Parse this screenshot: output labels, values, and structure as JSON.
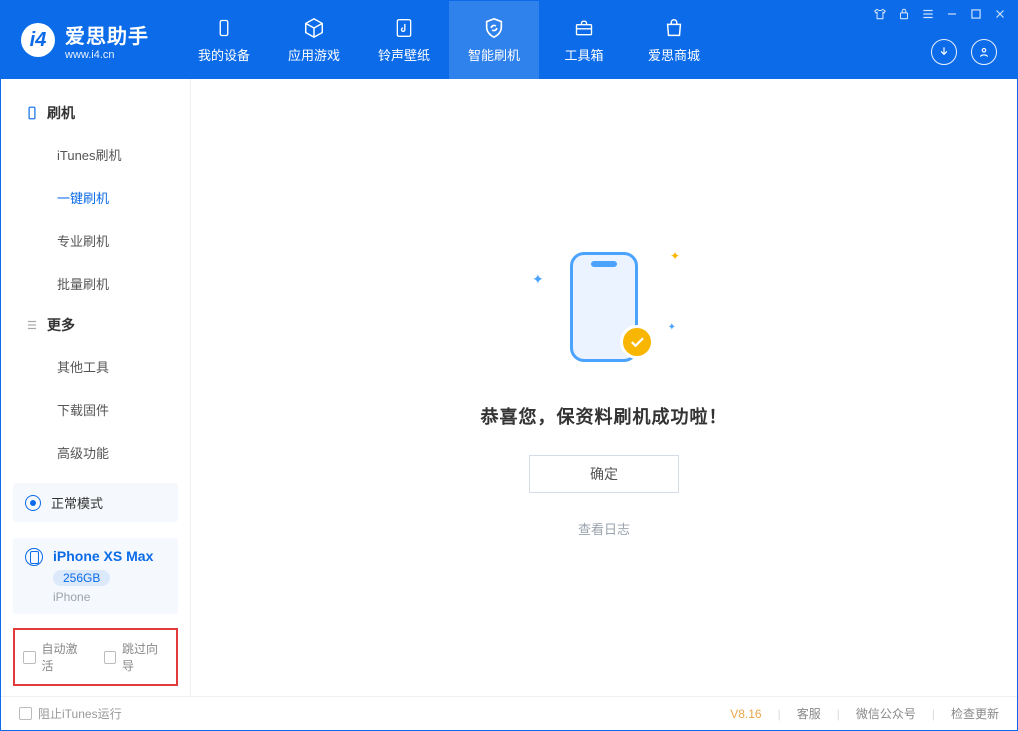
{
  "app": {
    "title": "爱思助手",
    "subtitle": "www.i4.cn"
  },
  "nav": {
    "tabs": [
      {
        "label": "我的设备",
        "icon": "device"
      },
      {
        "label": "应用游戏",
        "icon": "cube"
      },
      {
        "label": "铃声壁纸",
        "icon": "music"
      },
      {
        "label": "智能刷机",
        "icon": "shield"
      },
      {
        "label": "工具箱",
        "icon": "toolbox"
      },
      {
        "label": "爱思商城",
        "icon": "bag"
      }
    ],
    "active_index": 3
  },
  "sidebar": {
    "groups": [
      {
        "title": "刷机",
        "items": [
          {
            "label": "iTunes刷机"
          },
          {
            "label": "一键刷机",
            "active": true
          },
          {
            "label": "专业刷机"
          },
          {
            "label": "批量刷机"
          }
        ]
      },
      {
        "title": "更多",
        "items": [
          {
            "label": "其他工具"
          },
          {
            "label": "下载固件"
          },
          {
            "label": "高级功能"
          }
        ]
      }
    ],
    "mode_label": "正常模式",
    "device": {
      "name": "iPhone XS Max",
      "storage": "256GB",
      "type": "iPhone"
    },
    "checks": {
      "auto_activate": "自动激活",
      "skip_guide": "跳过向导"
    }
  },
  "main": {
    "success_message": "恭喜您，保资料刷机成功啦！",
    "ok_label": "确定",
    "log_link": "查看日志"
  },
  "footer": {
    "block_itunes": "阻止iTunes运行",
    "version": "V8.16",
    "links": {
      "service": "客服",
      "wechat": "微信公众号",
      "update": "检查更新"
    }
  }
}
